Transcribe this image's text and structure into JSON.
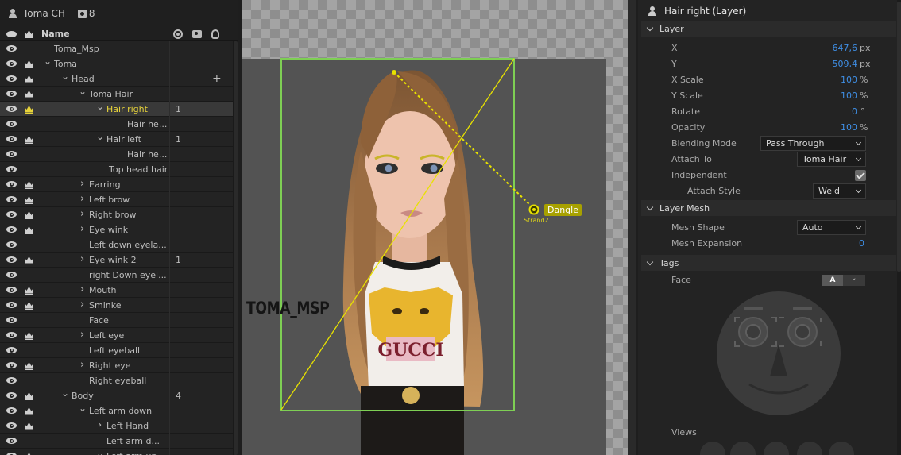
{
  "left_panel": {
    "puppet_name": "Toma CH",
    "count": "8",
    "col_name": "Name"
  },
  "layers": [
    {
      "label": "Toma_Msp",
      "indent": 0,
      "twisty": "",
      "crown": false,
      "num": "",
      "plus": false,
      "selected": false
    },
    {
      "label": "Toma",
      "indent": 0,
      "twisty": "down",
      "crown": true,
      "num": "",
      "plus": false,
      "selected": false
    },
    {
      "label": "Head",
      "indent": 1,
      "twisty": "down",
      "crown": true,
      "num": "",
      "plus": true,
      "selected": false
    },
    {
      "label": "Toma Hair",
      "indent": 2,
      "twisty": "down",
      "crown": true,
      "num": "",
      "plus": false,
      "selected": false
    },
    {
      "label": "Hair right",
      "indent": 3,
      "twisty": "down",
      "crown": true,
      "num": "1",
      "plus": false,
      "selected": true
    },
    {
      "label": "Hair he...",
      "indent": 5,
      "twisty": "",
      "crown": false,
      "num": "",
      "plus": false,
      "selected": false
    },
    {
      "label": "Hair left",
      "indent": 3,
      "twisty": "down",
      "crown": true,
      "num": "1",
      "plus": false,
      "selected": false
    },
    {
      "label": "Hair he...",
      "indent": 5,
      "twisty": "",
      "crown": false,
      "num": "",
      "plus": false,
      "selected": false
    },
    {
      "label": "Top head hair",
      "indent": 4,
      "twisty": "",
      "crown": false,
      "num": "",
      "plus": false,
      "selected": false
    },
    {
      "label": "Earring",
      "indent": 2,
      "twisty": "right",
      "crown": true,
      "num": "",
      "plus": false,
      "selected": false
    },
    {
      "label": "Left brow",
      "indent": 2,
      "twisty": "right",
      "crown": true,
      "num": "",
      "plus": false,
      "selected": false
    },
    {
      "label": "Right brow",
      "indent": 2,
      "twisty": "right",
      "crown": true,
      "num": "",
      "plus": false,
      "selected": false
    },
    {
      "label": "Eye wink",
      "indent": 2,
      "twisty": "right",
      "crown": true,
      "num": "",
      "plus": false,
      "selected": false
    },
    {
      "label": "Left down eyela...",
      "indent": 2,
      "twisty": "",
      "crown": false,
      "num": "",
      "plus": false,
      "selected": false
    },
    {
      "label": "Eye wink 2",
      "indent": 2,
      "twisty": "right",
      "crown": true,
      "num": "1",
      "plus": false,
      "selected": false
    },
    {
      "label": "right Down eyel...",
      "indent": 2,
      "twisty": "",
      "crown": false,
      "num": "",
      "plus": false,
      "selected": false
    },
    {
      "label": "Mouth",
      "indent": 2,
      "twisty": "right",
      "crown": true,
      "num": "",
      "plus": false,
      "selected": false
    },
    {
      "label": "Sminke",
      "indent": 2,
      "twisty": "right",
      "crown": true,
      "num": "",
      "plus": false,
      "selected": false
    },
    {
      "label": "Face",
      "indent": 2,
      "twisty": "",
      "crown": false,
      "num": "",
      "plus": false,
      "selected": false
    },
    {
      "label": "Left eye",
      "indent": 2,
      "twisty": "right",
      "crown": true,
      "num": "",
      "plus": false,
      "selected": false
    },
    {
      "label": "Left eyeball",
      "indent": 2,
      "twisty": "",
      "crown": false,
      "num": "",
      "plus": false,
      "selected": false
    },
    {
      "label": "Right eye",
      "indent": 2,
      "twisty": "right",
      "crown": true,
      "num": "",
      "plus": false,
      "selected": false
    },
    {
      "label": "Right eyeball",
      "indent": 2,
      "twisty": "",
      "crown": false,
      "num": "",
      "plus": false,
      "selected": false
    },
    {
      "label": "Body",
      "indent": 1,
      "twisty": "down",
      "crown": true,
      "num": "4",
      "plus": false,
      "selected": false
    },
    {
      "label": "Left arm down",
      "indent": 2,
      "twisty": "down",
      "crown": true,
      "num": "",
      "plus": false,
      "selected": false
    },
    {
      "label": "Left Hand",
      "indent": 3,
      "twisty": "right",
      "crown": true,
      "num": "",
      "plus": false,
      "selected": false
    },
    {
      "label": "Left arm d...",
      "indent": 3,
      "twisty": "",
      "crown": false,
      "num": "",
      "plus": false,
      "selected": false
    },
    {
      "label": "Left arm up",
      "indent": 3,
      "twisty": "down",
      "crown": true,
      "num": "",
      "plus": false,
      "selected": false
    }
  ],
  "canvas": {
    "watermark": "TOMA_MSP",
    "handle_label": "Dangle",
    "handle_sub": "Strand2"
  },
  "properties": {
    "title": "Hair right (Layer)",
    "layer_section": "Layer",
    "x_label": "X",
    "x_value": "647,6",
    "x_unit": "px",
    "y_label": "Y",
    "y_value": "509,4",
    "y_unit": "px",
    "xscale_label": "X Scale",
    "xscale_value": "100",
    "xscale_unit": "%",
    "yscale_label": "Y Scale",
    "yscale_value": "100",
    "yscale_unit": "%",
    "rotate_label": "Rotate",
    "rotate_value": "0",
    "rotate_unit": "°",
    "opacity_label": "Opacity",
    "opacity_value": "100",
    "opacity_unit": "%",
    "blend_label": "Blending Mode",
    "blend_value": "Pass Through",
    "attach_label": "Attach To",
    "attach_value": "Toma Hair",
    "independent_label": "Independent",
    "attach_style_label": "Attach Style",
    "attach_style_value": "Weld",
    "mesh_section": "Layer Mesh",
    "mesh_shape_label": "Mesh Shape",
    "mesh_shape_value": "Auto",
    "mesh_exp_label": "Mesh Expansion",
    "mesh_exp_value": "0",
    "tags_section": "Tags",
    "face_label": "Face",
    "seg_a": "A",
    "seg_b": "ᵕ",
    "views_label": "Views"
  },
  "colors": {
    "accent_blue": "#3f8fe6",
    "selected_yellow": "#e6d23a",
    "green_bounds": "#7ecf54",
    "handle": "#a8a100"
  }
}
